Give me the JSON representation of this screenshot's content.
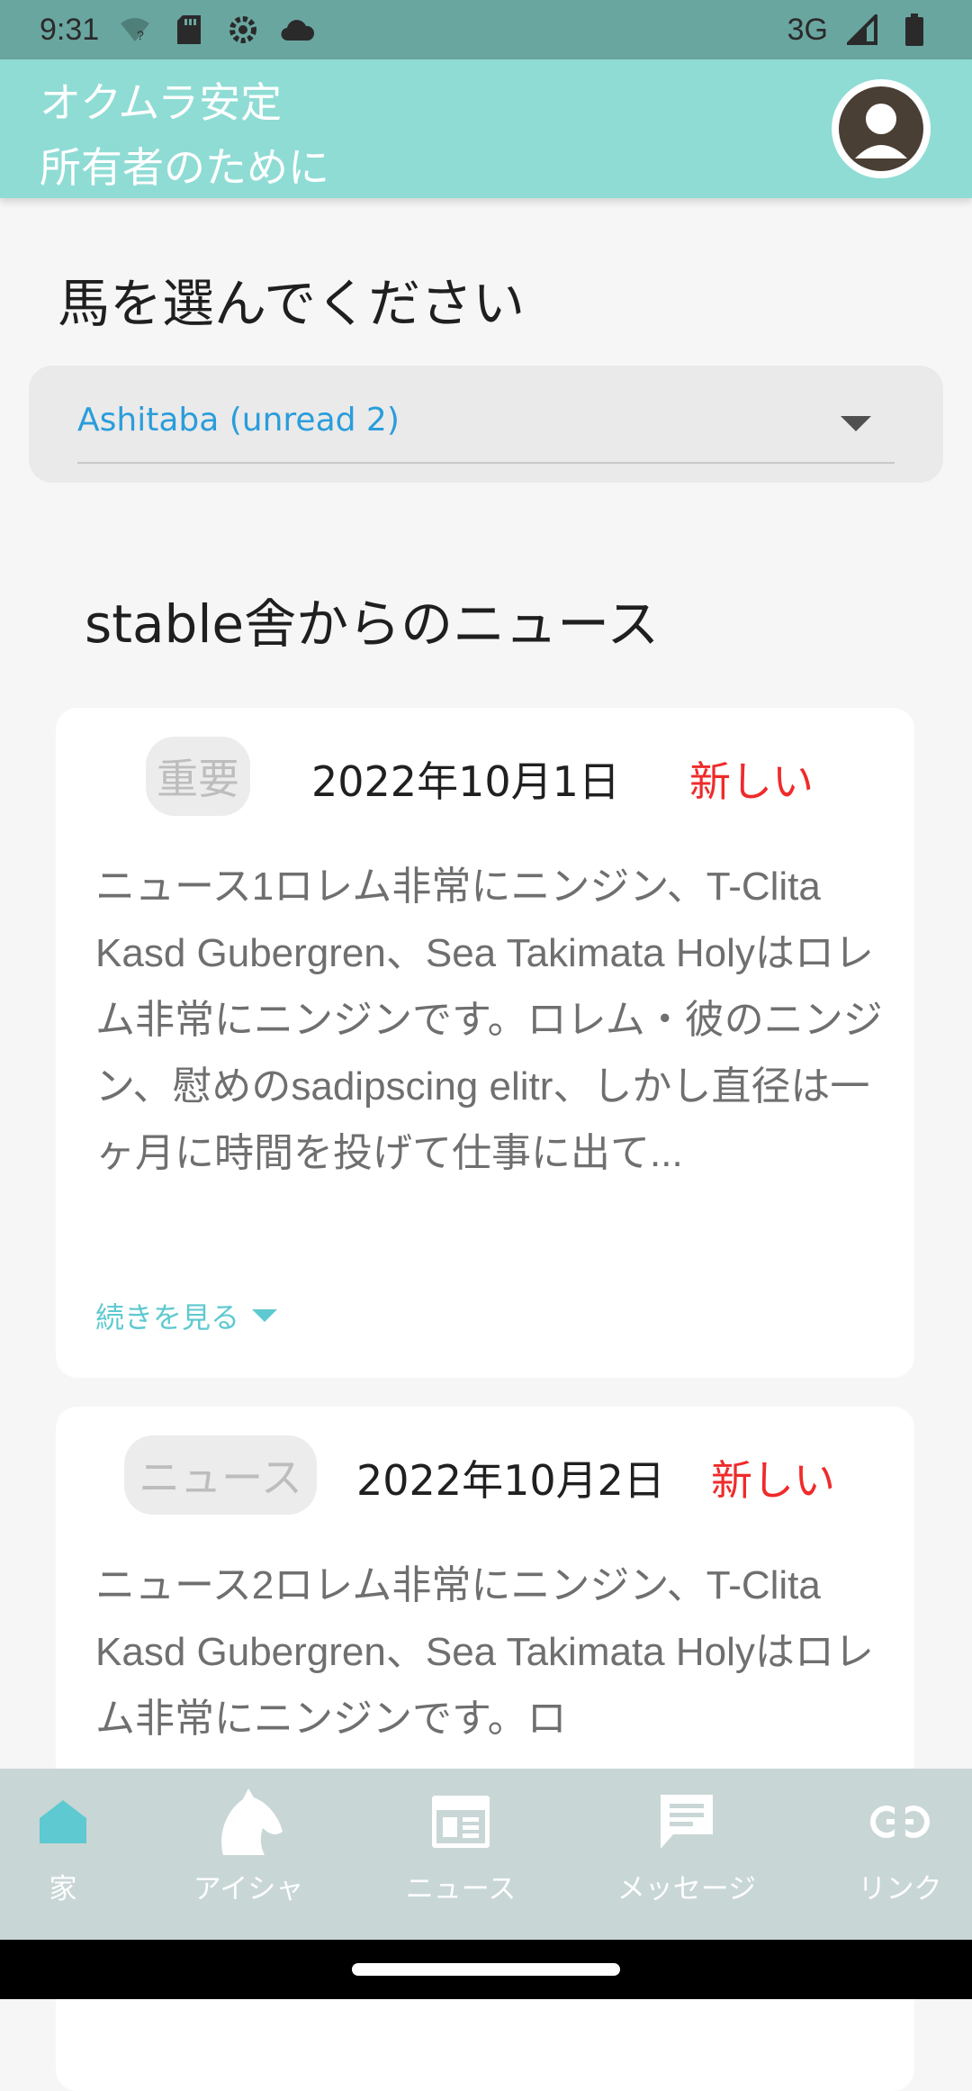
{
  "status_bar": {
    "time": "9:31",
    "network": "3G"
  },
  "app_bar": {
    "title_line1": "オクムラ安定",
    "title_line2": "所有者のために"
  },
  "horse_select": {
    "title": "馬を選んでください",
    "selected_value": "Ashitaba (unread 2)"
  },
  "news": {
    "title": "stable舎からのニュース",
    "items": [
      {
        "tag": "重要",
        "date": "2022年10月1日",
        "status": "新しい",
        "text": "ニュース1ロレム非常にニンジン、T-Clita Kasd Gubergren、Sea Takimata Holyはロレム非常にニンジンです。ロレム・彼のニンジン、慰めのsadipscing elitr、しかし直径は一ヶ月に時間を投げて仕事に出て...",
        "more": "続きを見る"
      },
      {
        "tag": "ニュース",
        "date": "2022年10月2日",
        "status": "新しい",
        "text": "ニュース2ロレム非常にニンジン、T-Clita Kasd Gubergren、Sea Takimata Holyはロレム非常にニンジンです。ロ"
      }
    ]
  },
  "bottom_nav": {
    "items": [
      {
        "label": "家",
        "icon": "home-icon",
        "active": true
      },
      {
        "label": "アイシャ",
        "icon": "horse-icon"
      },
      {
        "label": "ニュース",
        "icon": "newspaper-icon"
      },
      {
        "label": "メッセージ",
        "icon": "message-icon"
      },
      {
        "label": "リンク",
        "icon": "link-icon"
      }
    ]
  },
  "colors": {
    "status_bar": "#6aa6a0",
    "app_bar": "#8fdcd5",
    "accent_blue": "#2a9ddb",
    "new_red": "#ef2b2b",
    "nav_active": "#5ec9d0",
    "bottom_nav": "#c9d6d6"
  }
}
